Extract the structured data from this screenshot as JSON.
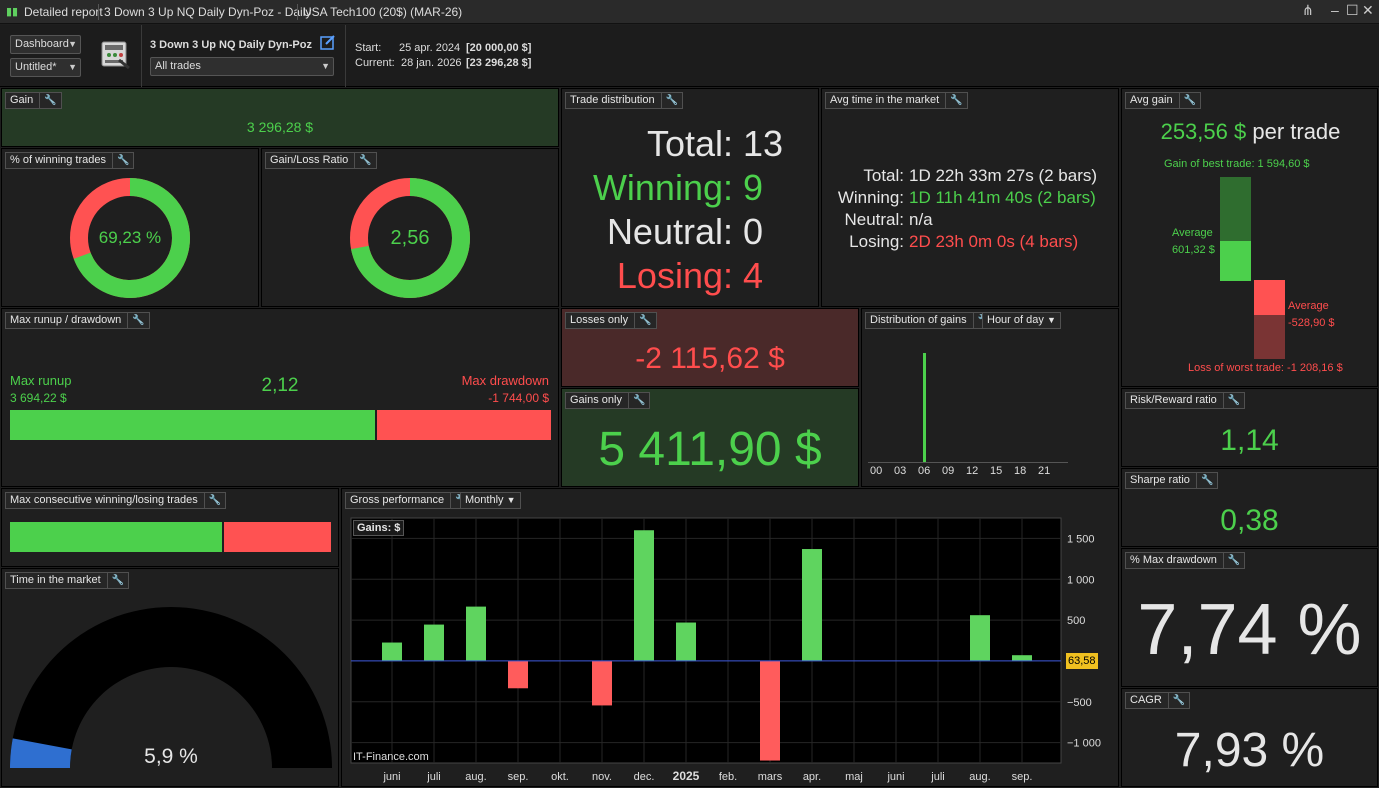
{
  "titlebar": {
    "report": "Detailed report",
    "strategy": "3 Down  3 Up NQ Daily Dyn-Poz - Daily",
    "instrument": "USA Tech100 (20$) (MAR-26)"
  },
  "header": {
    "view_select": "Dashboard",
    "layout_select": "Untitled*",
    "strategy_name": "3 Down  3 Up NQ Daily Dyn-Poz",
    "trades_select": "All trades",
    "start_label": "Start:",
    "start_date": "25 apr. 2024",
    "start_amount": "[20 000,00 $]",
    "current_label": "Current:",
    "current_date": "28 jan. 2026",
    "current_amount": "[23 296,28 $]"
  },
  "gain": {
    "title": "Gain",
    "value": "3 296,28 $"
  },
  "winning_pct": {
    "title": "% of winning trades",
    "value": "69,23 %",
    "fraction": 0.6923
  },
  "gain_loss_ratio": {
    "title": "Gain/Loss Ratio",
    "value": "2,56",
    "fraction": 0.719
  },
  "trade_distribution": {
    "title": "Trade distribution",
    "rows": [
      {
        "label": "Total:",
        "value": "13"
      },
      {
        "label": "Winning:",
        "value": "9"
      },
      {
        "label": "Neutral:",
        "value": "0"
      },
      {
        "label": "Losing:",
        "value": "4"
      }
    ]
  },
  "avg_time": {
    "title": "Avg time in the market",
    "rows": [
      {
        "label": "Total:",
        "value": "1D 22h 33m 27s (2 bars)"
      },
      {
        "label": "Winning:",
        "value": "1D 11h 41m 40s (2 bars)"
      },
      {
        "label": "Neutral:",
        "value": "n/a"
      },
      {
        "label": "Losing:",
        "value": "2D 23h 0m 0s (4 bars)"
      }
    ]
  },
  "avg_gain": {
    "title": "Avg gain",
    "value": "253,56 $",
    "suffix": "per trade",
    "best_trade": "Gain of best trade: 1 594,60 $",
    "avg_gain_label": "Average",
    "avg_gain_value": "601,32 $",
    "avg_loss_label": "Average",
    "avg_loss_value": "-528,90 $",
    "worst_trade": "Loss of worst trade: -1 208,16 $"
  },
  "runup": {
    "title": "Max runup / drawdown",
    "runup_label": "Max runup",
    "runup_value": "3 694,22 $",
    "ratio": "2,12",
    "drawdown_label": "Max drawdown",
    "drawdown_value": "-1 744,00 $",
    "runup_fraction": 0.679
  },
  "losses_only": {
    "title": "Losses only",
    "value": "-2 115,62 $"
  },
  "gains_only": {
    "title": "Gains only",
    "value": "5 411,90 $"
  },
  "dist_gains": {
    "title": "Distribution of gains",
    "dropdown": "Hour of day",
    "hour_ticks": [
      "00",
      "03",
      "06",
      "09",
      "12",
      "15",
      "18",
      "21"
    ]
  },
  "risk_reward": {
    "title": "Risk/Reward ratio",
    "value": "1,14"
  },
  "sharpe": {
    "title": "Sharpe ratio",
    "value": "0,38"
  },
  "max_dd_pct": {
    "title": "% Max drawdown",
    "value": "7,74 %"
  },
  "cagr": {
    "title": "CAGR",
    "value": "7,93 %"
  },
  "consecutive": {
    "title": "Max consecutive winning/losing trades",
    "win_fraction": 0.667
  },
  "time_market": {
    "title": "Time in the market",
    "value": "5,9 %",
    "fraction": 0.059
  },
  "gross_perf": {
    "title": "Gross performance",
    "dropdown": "Monthly",
    "legend": "Gains: $",
    "watermark": "IT-Finance.com",
    "last_value": "63,58"
  },
  "colors": {
    "green": "#4cd04c",
    "red": "#ff5252",
    "dark_green": "#2f6d2f",
    "dark_red": "#7a3434",
    "blue": "#2f6fd0"
  },
  "chart_data": {
    "type": "bar",
    "ylabel": "Gains: $",
    "categories": [
      "juni",
      "juli",
      "aug.",
      "sep.",
      "okt.",
      "nov.",
      "dec.",
      "2025",
      "feb.",
      "mars",
      "apr.",
      "maj",
      "juni",
      "juli",
      "aug.",
      "sep."
    ],
    "values": [
      225,
      445,
      665,
      -335,
      0,
      -545,
      1600,
      470,
      0,
      -1220,
      1370,
      0,
      0,
      0,
      560,
      70
    ],
    "ylim": [
      -1250,
      1750
    ],
    "yticks": [
      -1000,
      -500,
      0,
      500,
      1000,
      1500
    ],
    "ytick_labels": [
      "−1 000",
      "−500",
      "0",
      "500",
      "1 000",
      "1 500"
    ],
    "grid": true
  }
}
